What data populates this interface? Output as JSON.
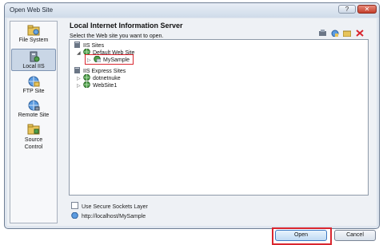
{
  "window": {
    "title": "Open Web Site",
    "help_label": "?",
    "close_label": "✕"
  },
  "sidebar": {
    "items": [
      {
        "label": "File System",
        "icon": "folder-system-icon"
      },
      {
        "label": "Local IIS",
        "icon": "local-iis-icon",
        "selected": true
      },
      {
        "label": "FTP Site",
        "icon": "ftp-site-icon"
      },
      {
        "label": "Remote Site",
        "icon": "remote-site-icon"
      },
      {
        "label": "Source Control",
        "icon": "source-control-icon"
      }
    ]
  },
  "main": {
    "heading": "Local Internet Information Server",
    "instruction": "Select the Web site you want to open.",
    "toolbar_icons": [
      "new-web-app-icon",
      "new-virtual-dir-icon",
      "new-folder-icon",
      "delete-icon"
    ]
  },
  "tree": {
    "iis_sites": "IIS Sites",
    "default_web_site": "Default Web Site",
    "mysample": "MySample",
    "iis_express_sites": "IIS Express Sites",
    "dotnetnuke": "dotnetnuke",
    "website1": "WebSite1"
  },
  "options": {
    "ssl_label": "Use Secure Sockets Layer",
    "ssl_checked": false
  },
  "url": "http://localhost/MySample",
  "buttons": {
    "open": "Open",
    "cancel": "Cancel"
  },
  "colors": {
    "highlight": "#d9262f",
    "accent": "#3c79c2"
  }
}
